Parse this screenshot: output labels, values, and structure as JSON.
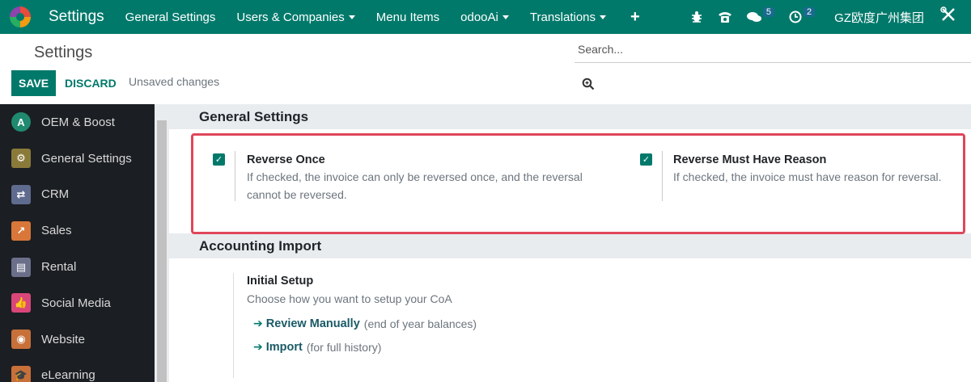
{
  "navbar": {
    "app_title": "Settings",
    "menus": [
      {
        "label": "General Settings",
        "dropdown": false
      },
      {
        "label": "Users & Companies",
        "dropdown": true
      },
      {
        "label": "Menu Items",
        "dropdown": false
      },
      {
        "label": "odooAi",
        "dropdown": true
      },
      {
        "label": "Translations",
        "dropdown": true
      }
    ],
    "plus": "+",
    "chat_count": "5",
    "activity_count": "2",
    "company": "GZ欧度广州集团"
  },
  "control_panel": {
    "title": "Settings",
    "save_label": "SAVE",
    "discard_label": "DISCARD",
    "status": "Unsaved changes",
    "search_placeholder": "Search..."
  },
  "sidebar": {
    "items": [
      {
        "label": "OEM & Boost",
        "icon": "ai-icon",
        "color": "#1f8a70"
      },
      {
        "label": "General Settings",
        "icon": "gear-icon",
        "color": "#8a7a3a"
      },
      {
        "label": "CRM",
        "icon": "handshake-icon",
        "color": "#5f6b8e"
      },
      {
        "label": "Sales",
        "icon": "chart-icon",
        "color": "#d9773a"
      },
      {
        "label": "Rental",
        "icon": "rental-icon",
        "color": "#6b6f8a"
      },
      {
        "label": "Social Media",
        "icon": "thumbs-up-icon",
        "color": "#d9467a"
      },
      {
        "label": "Website",
        "icon": "globe-icon",
        "color": "#c8703a"
      },
      {
        "label": "eLearning",
        "icon": "graduation-icon",
        "color": "#c8703a"
      }
    ]
  },
  "general_settings": {
    "header": "General Settings",
    "settings": [
      {
        "title": "Reverse Once",
        "description_line1": "If checked, the invoice can only be reversed once, and the reversal",
        "description_line2": "cannot be reversed.",
        "checked": true
      },
      {
        "title": "Reverse Must Have Reason",
        "description_line1": "If checked, the invoice must have reason for reversal.",
        "checked": true
      }
    ]
  },
  "accounting_import": {
    "header": "Accounting Import",
    "title": "Initial Setup",
    "description": "Choose how you want to setup your CoA",
    "links": [
      {
        "label": "Review Manually",
        "note": "(end of year balances)"
      },
      {
        "label": "Import",
        "note": "(for full history)"
      }
    ]
  }
}
